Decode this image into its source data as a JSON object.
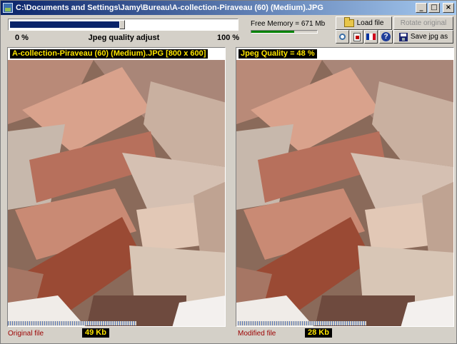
{
  "window": {
    "title": "C:\\Documents and Settings\\Jamy\\Bureau\\A-collection-Piraveau (60) (Medium).JPG",
    "minimize_glyph": "_",
    "maximize_glyph": "□",
    "close_glyph": "×"
  },
  "quality_slider": {
    "min_label": "0 %",
    "title": "Jpeg quality adjust",
    "max_label": "100 %",
    "value_percent": 48
  },
  "memory": {
    "label": "Free Memory = 671 Mb",
    "bar_fraction": 0.65,
    "bar_color": "#008000"
  },
  "toolbar": {
    "load_label": "Load file",
    "rotate_label": "Rotate original",
    "save_label": "Save jpg as",
    "icons": [
      "preview-icon",
      "document-icon",
      "french-flag-icon",
      "help-icon"
    ]
  },
  "original_panel": {
    "caption": "A-collection-Piraveau (60) (Medium).JPG  [800 x 600]",
    "footer_label": "Original file",
    "size": "49  Kb"
  },
  "modified_panel": {
    "caption": "Jpeg Quality = 48 %",
    "footer_label": "Modified file",
    "size": "28  Kb"
  },
  "colors": {
    "title_gradient_start": "#0a246a",
    "title_gradient_end": "#a6caf0",
    "caption_text": "#ffe600",
    "footer_text": "#9c0000",
    "flag_blue": "#0033a0",
    "flag_red": "#d0021b"
  }
}
